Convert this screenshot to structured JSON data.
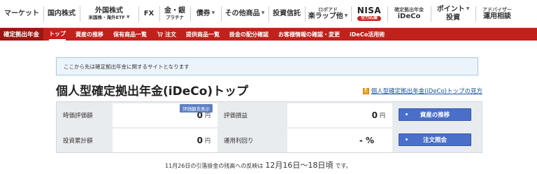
{
  "nav": {
    "market": "マーケット",
    "domestic_stock": "国内株式",
    "foreign_stock": "外国株式",
    "foreign_stock_sub": "米国株・海外ETF",
    "fx": "FX",
    "gold": "金・銀",
    "gold_sub": "プラチナ",
    "bonds": "債券",
    "others": "その他商品",
    "trust": "投資信託",
    "robo_small": "ロボアド",
    "robo": "楽ラップ他",
    "nisa": "NISA",
    "nisa_badge": "全力応援",
    "ideco_small": "確定拠出年金",
    "ideco": "iDeCo",
    "points1": "ポイント",
    "points2": "投資",
    "advisor_small": "アドバイザー",
    "advisor": "運用相談"
  },
  "subnav": {
    "section_title": "確定拠出年金",
    "items": [
      "トップ",
      "資産の推移",
      "保有商品一覧",
      "注文",
      "提供商品一覧",
      "掛金の配分確認",
      "お客様情報の確認・変更",
      "iDeCo活用術"
    ]
  },
  "notice": "ここから先は確定拠出年金に関するサイトとなります",
  "page_title": "個人型確定拠出年金(iDeCo)トップ",
  "help_link": "個人型確定拠出年金(iDeCo)トップの見方",
  "summary": {
    "market_value_label": "時価評価額",
    "market_value_badge": "評価額非表示",
    "market_value": "0",
    "pnl_label": "評価損益",
    "pnl": "0",
    "invested_label": "投資累計額",
    "invested": "0",
    "yield_label": "運用利回り",
    "yield": "- %",
    "unit": "円",
    "btn_assets": "資産の推移",
    "btn_orders": "注文照会"
  },
  "footnote": {
    "pre": "11月26日の引落掛金の残高への反映は",
    "date": "12月16日〜18日頃",
    "post": "です。"
  }
}
